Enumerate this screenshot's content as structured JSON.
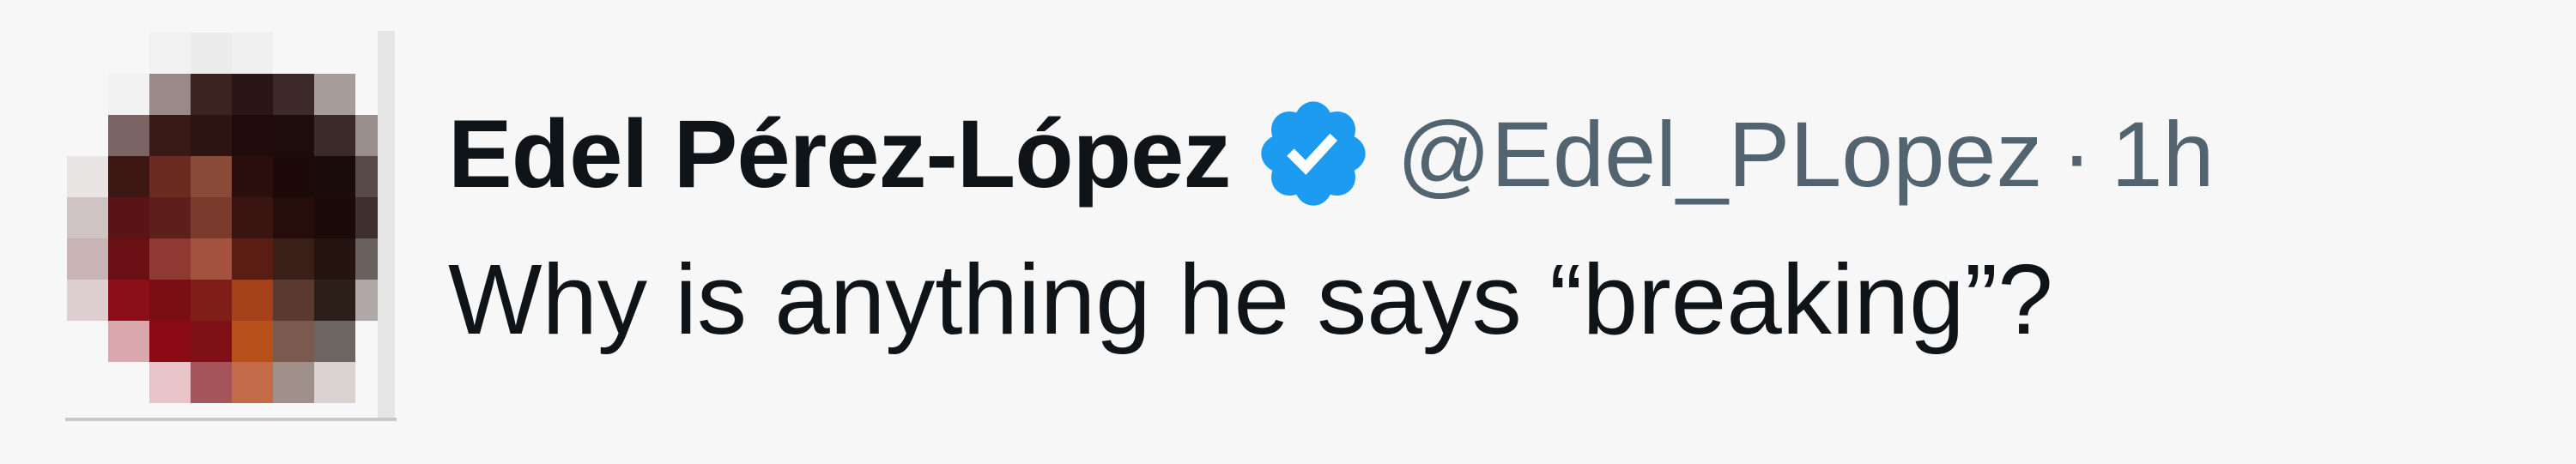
{
  "tweet": {
    "author": {
      "display_name": "Edel Pérez-López",
      "handle": "@Edel_PLopez",
      "verified": true,
      "verified_icon": "verified-badge-icon",
      "verified_color": "#1d9bf0",
      "avatar": "pixelated-avatar"
    },
    "separator": "·",
    "time": "1h",
    "text": "Why is anything he says “breaking”?"
  }
}
